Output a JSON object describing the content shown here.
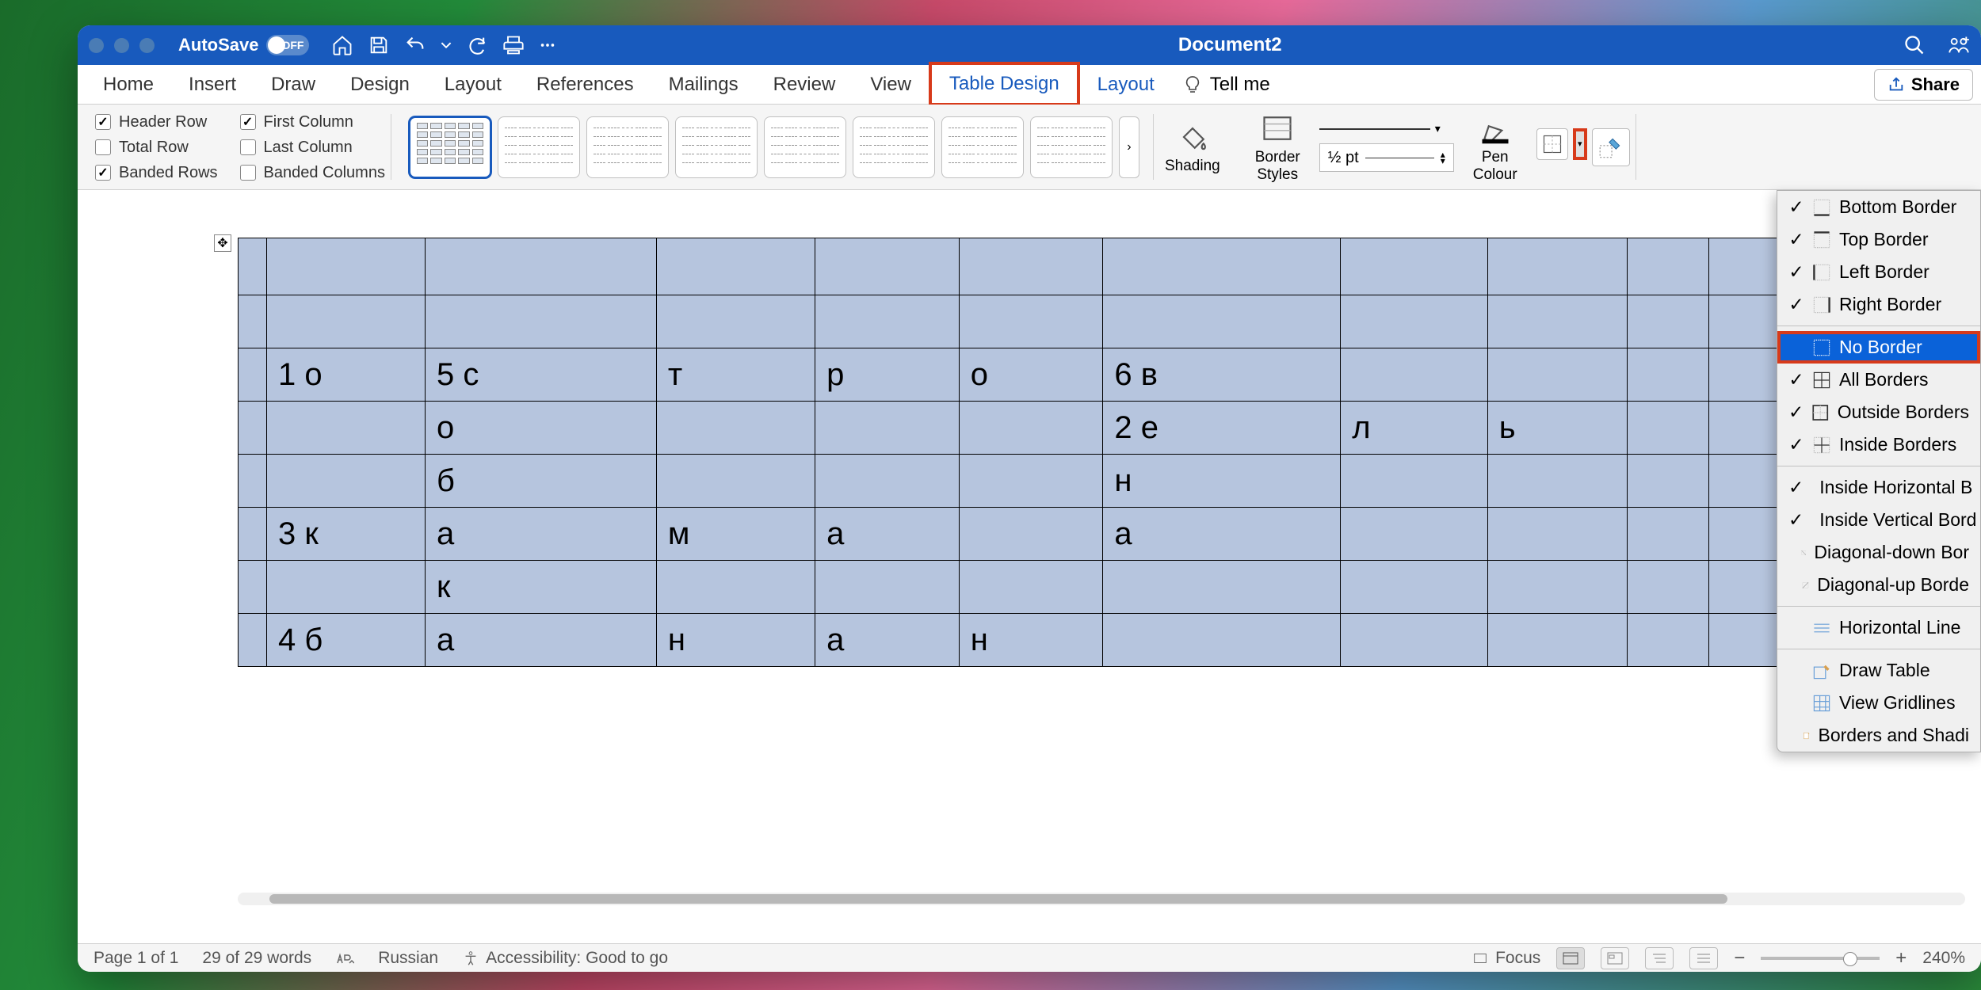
{
  "titlebar": {
    "autosave_label": "AutoSave",
    "autosave_state": "OFF",
    "doc_title": "Document2"
  },
  "tabs": {
    "home": "Home",
    "insert": "Insert",
    "draw": "Draw",
    "design": "Design",
    "layout": "Layout",
    "references": "References",
    "mailings": "Mailings",
    "review": "Review",
    "view": "View",
    "table_design": "Table Design",
    "layout2": "Layout",
    "tellme": "Tell me",
    "share": "Share"
  },
  "options": {
    "header_row": "Header Row",
    "total_row": "Total Row",
    "banded_rows": "Banded Rows",
    "first_col": "First Column",
    "last_col": "Last Column",
    "banded_cols": "Banded Columns"
  },
  "ribbon": {
    "shading": "Shading",
    "border_styles": "Border\nStyles",
    "pt": "½ pt",
    "pen_colour": "Pen\nColour"
  },
  "borders_menu": {
    "bottom": "Bottom Border",
    "top": "Top Border",
    "left": "Left Border",
    "right": "Right Border",
    "none": "No Border",
    "all": "All Borders",
    "outside": "Outside Borders",
    "inside": "Inside Borders",
    "inside_h": "Inside Horizontal B",
    "inside_v": "Inside Vertical Bord",
    "diag_down": "Diagonal-down Bor",
    "diag_up": "Diagonal-up Borde",
    "hline": "Horizontal Line",
    "draw": "Draw Table",
    "gridlines": "View Gridlines",
    "shading_dlg": "Borders and Shadi"
  },
  "table": {
    "rows": [
      [
        "",
        "",
        "",
        "",
        "",
        "",
        "",
        "",
        "",
        "",
        ""
      ],
      [
        "",
        "",
        "",
        "",
        "",
        "",
        "",
        "",
        "",
        "",
        ""
      ],
      [
        "",
        "1 о",
        "5 с",
        "т",
        "р",
        "о",
        "6 в",
        "",
        "",
        "",
        ""
      ],
      [
        "",
        "",
        "о",
        "",
        "",
        "",
        "2 е",
        "л",
        "ь",
        "",
        ""
      ],
      [
        "",
        "",
        "б",
        "",
        "",
        "",
        "н",
        "",
        "",
        "",
        ""
      ],
      [
        "",
        "3 к",
        "а",
        "м",
        "а",
        "",
        "а",
        "",
        "",
        "",
        ""
      ],
      [
        "",
        "",
        "к",
        "",
        "",
        "",
        "",
        "",
        "",
        "",
        ""
      ],
      [
        "",
        "4 б",
        "а",
        "н",
        "а",
        "н",
        "",
        "",
        "",
        "",
        ""
      ]
    ]
  },
  "status": {
    "page": "Page 1 of 1",
    "words": "29 of 29 words",
    "lang": "Russian",
    "a11y": "Accessibility: Good to go",
    "focus": "Focus",
    "zoom": "240%"
  }
}
